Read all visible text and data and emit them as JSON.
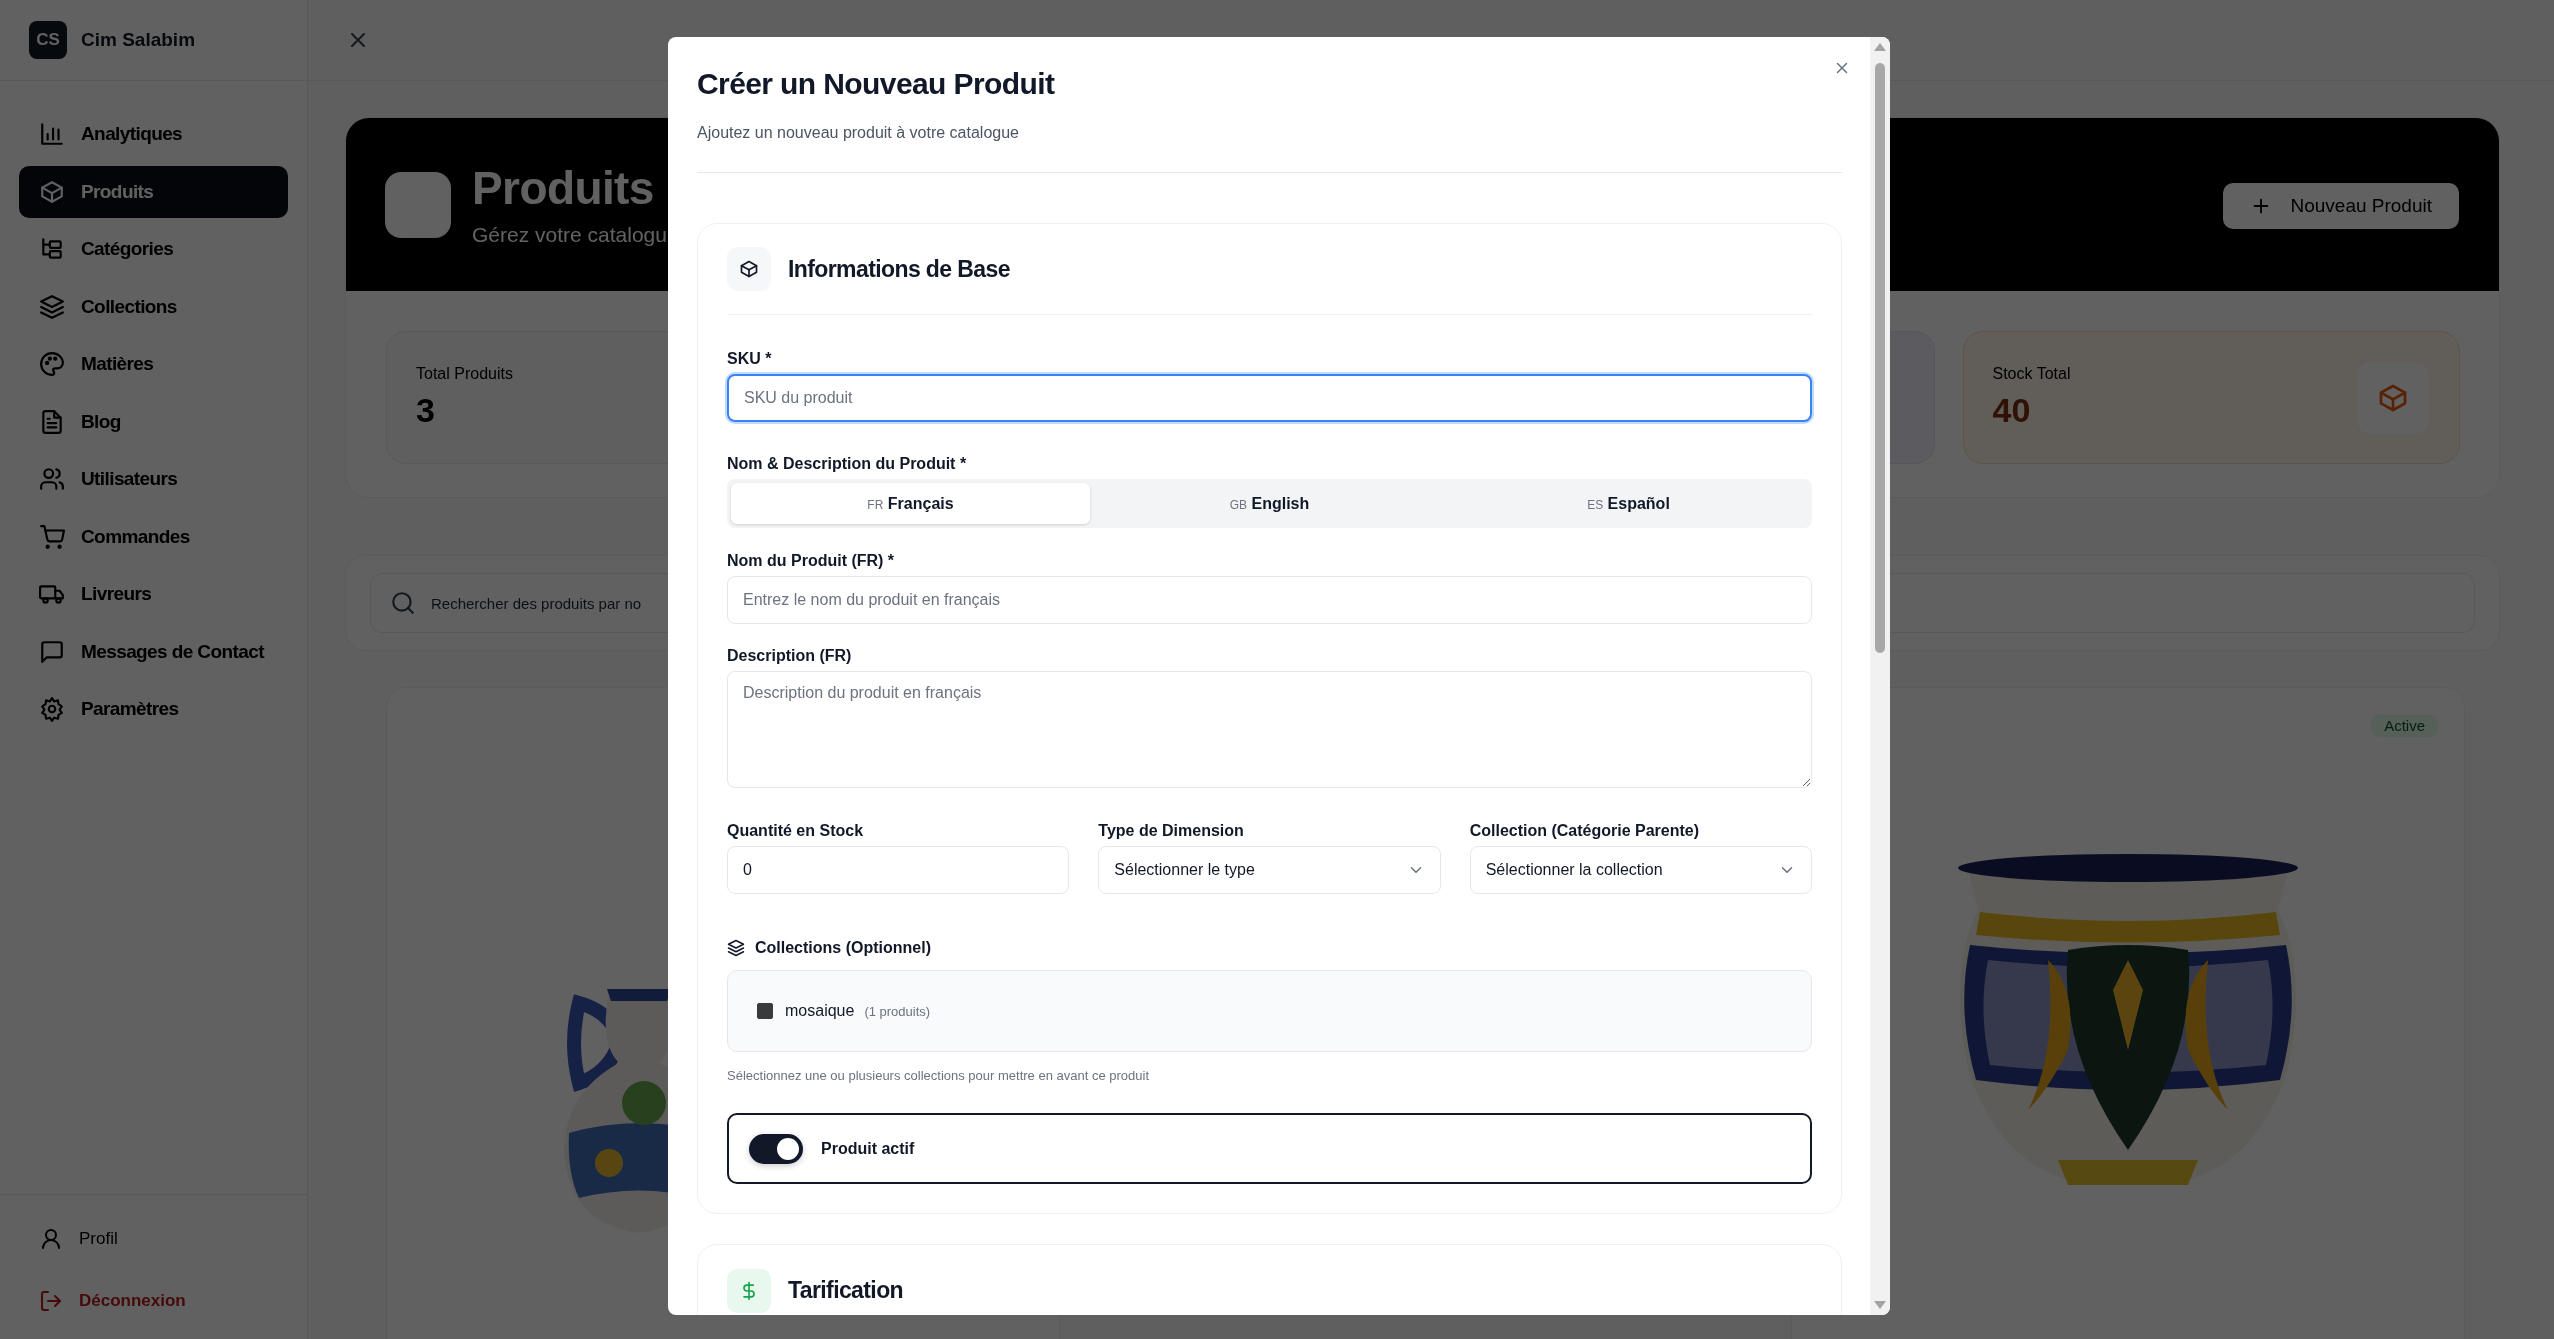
{
  "sidebar": {
    "logo": "CS",
    "brand": "Cim Salabim",
    "items": [
      {
        "label": "Analytiques",
        "selected": false
      },
      {
        "label": "Produits",
        "selected": true
      },
      {
        "label": "Catégories",
        "selected": false
      },
      {
        "label": "Collections",
        "selected": false
      },
      {
        "label": "Matières",
        "selected": false
      },
      {
        "label": "Blog",
        "selected": false
      },
      {
        "label": "Utilisateurs",
        "selected": false
      },
      {
        "label": "Commandes",
        "selected": false
      },
      {
        "label": "Livreurs",
        "selected": false
      },
      {
        "label": "Messages de Contact",
        "selected": false
      },
      {
        "label": "Paramètres",
        "selected": false
      }
    ],
    "footer": [
      {
        "label": "Profil",
        "kind": "profile"
      },
      {
        "label": "Déconnexion",
        "kind": "logout"
      }
    ]
  },
  "hero": {
    "title": "Produits",
    "subtitle": "Gérez votre catalogu",
    "button": "Nouveau Produit"
  },
  "stats": [
    {
      "label": "Total Produits",
      "value": "3",
      "kind": "plain"
    },
    {
      "label": "Stock Total",
      "value": "40",
      "kind": "stock"
    }
  ],
  "search": {
    "placeholder": "Rechercher des produits par no"
  },
  "products": [
    {
      "image": {
        "kind": "picture"
      }
    },
    {
      "status": "Active",
      "image": {
        "kind": "picture"
      }
    }
  ],
  "modal": {
    "title": "Créer un Nouveau Produit",
    "subtitle": "Ajoutez un nouveau produit à votre catalogue",
    "basic": {
      "title": "Informations de Base",
      "sku": {
        "label": "SKU *",
        "placeholder": "SKU du produit",
        "focused": true
      },
      "name_label": "Nom & Description du Produit *",
      "languages": [
        {
          "code": "FR",
          "label": "Français",
          "selected": true
        },
        {
          "code": "GB",
          "label": "English",
          "selected": false
        },
        {
          "code": "ES",
          "label": "Español",
          "selected": false
        }
      ],
      "name": {
        "label": "Nom du Produit (FR) *",
        "placeholder": "Entrez le nom du produit en français"
      },
      "description": {
        "label": "Description (FR)",
        "placeholder": "Description du produit en français"
      },
      "stock": {
        "label": "Quantité en Stock",
        "value": "0"
      },
      "dimension_type": {
        "label": "Type de Dimension",
        "value": "Sélectionner le type"
      },
      "parent_collection": {
        "label": "Collection (Catégorie Parente)",
        "value": "Sélectionner la collection"
      },
      "collections": {
        "label": "Collections (Optionnel)",
        "options": [
          {
            "name": "mosaique",
            "count": "(1 produits)",
            "checked": false
          }
        ],
        "hint": "Sélectionnez une ou plusieurs collections pour mettre en avant ce produit"
      },
      "active": {
        "label": "Produit actif",
        "on": true
      }
    },
    "pricing": {
      "title": "Tarification"
    }
  }
}
